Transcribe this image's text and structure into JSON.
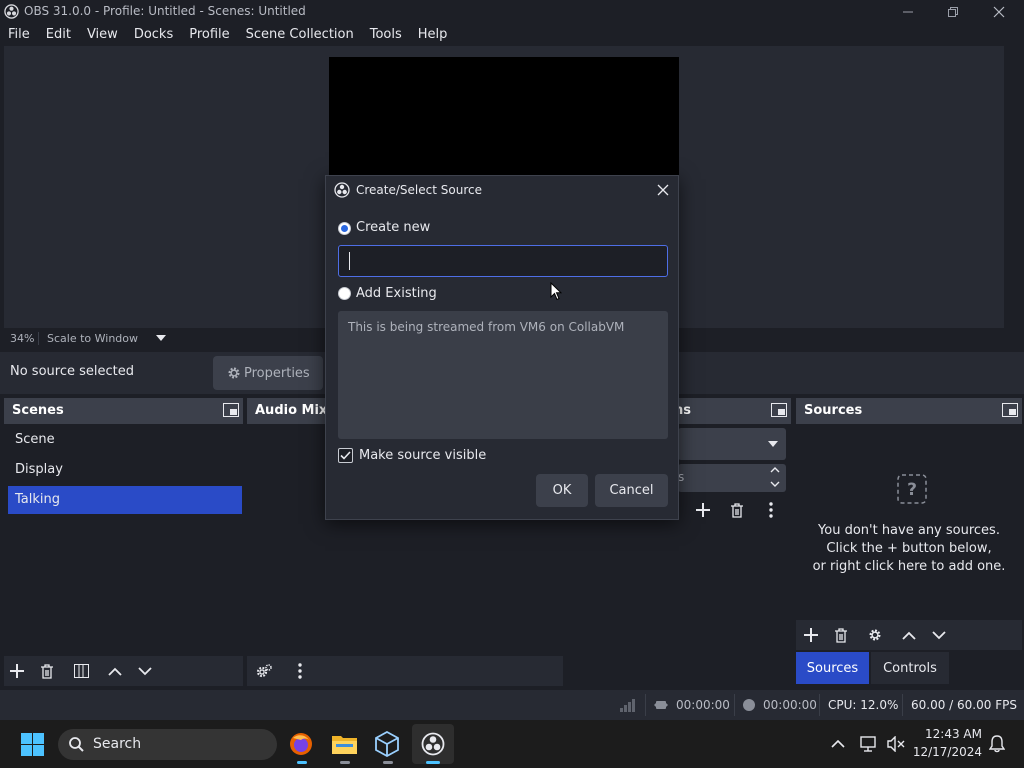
{
  "window": {
    "title": "OBS 31.0.0 - Profile: Untitled - Scenes: Untitled"
  },
  "menu": [
    "File",
    "Edit",
    "View",
    "Docks",
    "Profile",
    "Scene Collection",
    "Tools",
    "Help"
  ],
  "preview": {
    "zoom": "34%",
    "scale_mode": "Scale to Window"
  },
  "context_bar": {
    "selection": "No source selected",
    "properties_label": "Properties"
  },
  "docks": {
    "scenes": {
      "title": "Scenes",
      "items": [
        "Scene",
        "Display",
        "Talking"
      ],
      "selected_index": 2
    },
    "audio_mixer": {
      "title": "Audio Mixe"
    },
    "transitions": {
      "title": "ns",
      "duration_suffix": "s"
    },
    "sources": {
      "title": "Sources",
      "empty_line1": "You don't have any sources.",
      "empty_line2": "Click the + button below,",
      "empty_line3": "or right click here to add one.",
      "tabs": [
        "Sources",
        "Controls"
      ]
    }
  },
  "dialog": {
    "title": "Create/Select Source",
    "create_new_label": "Create new",
    "name_value": "",
    "add_existing_label": "Add Existing",
    "existing_items": [
      "This is being streamed from VM6 on CollabVM"
    ],
    "make_visible_label": "Make source visible",
    "ok_label": "OK",
    "cancel_label": "Cancel"
  },
  "statusbar": {
    "stream_time": "00:00:00",
    "record_time": "00:00:00",
    "cpu": "CPU: 12.0%",
    "fps": "60.00 / 60.00 FPS"
  },
  "taskbar": {
    "search_placeholder": "Search",
    "time": "12:43 AM",
    "date": "12/17/2024"
  },
  "colors": {
    "accent": "#2a4bc7",
    "panel": "#272a33",
    "background": "#1d1f26"
  }
}
